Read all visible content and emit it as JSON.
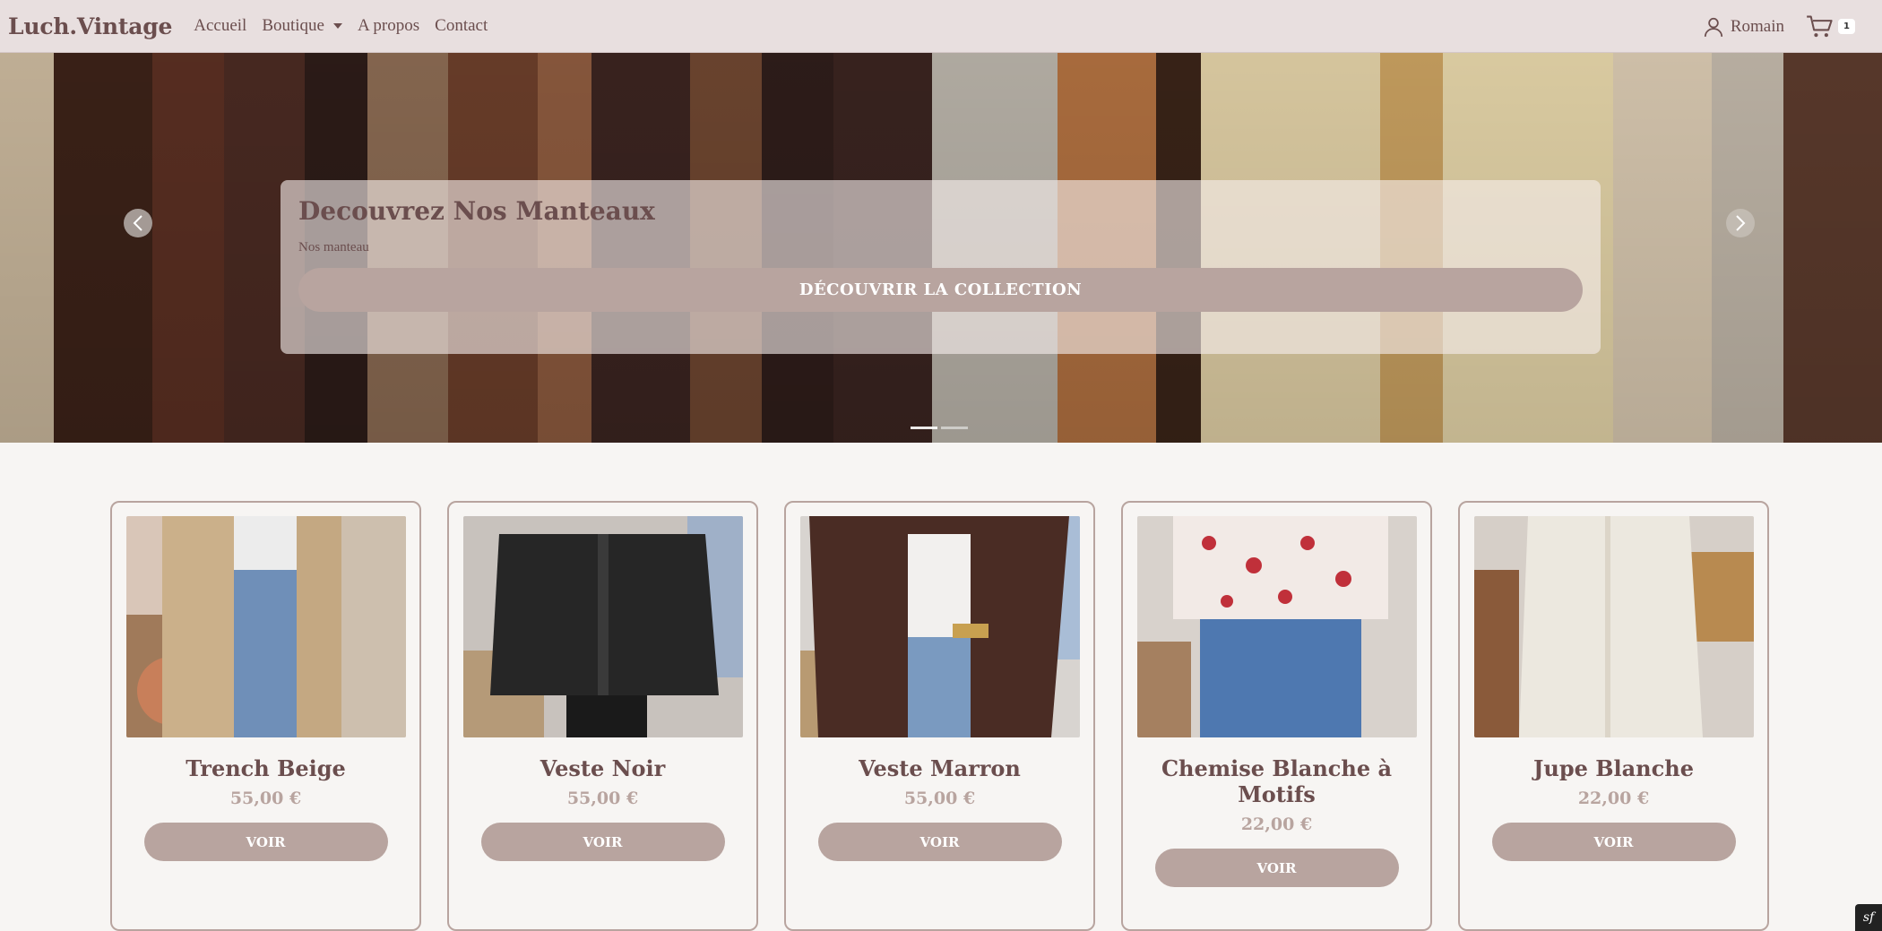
{
  "nav": {
    "brand": "Luch.Vintage",
    "links": [
      "Accueil",
      "Boutique",
      "A propos",
      "Contact"
    ],
    "user_name": "Romain",
    "cart_count": "1"
  },
  "hero": {
    "title": "Decouvrez Nos Manteaux",
    "subtitle": "Nos manteau",
    "button_label": "DÉCOUVRIR LA COLLECTION",
    "slides_count": 2,
    "active_slide": 1
  },
  "products": [
    {
      "name": "Trench Beige",
      "price": "55,00 €",
      "button": "VOIR",
      "photo": "trench-beige-photo"
    },
    {
      "name": "Veste Noir",
      "price": "55,00 €",
      "button": "VOIR",
      "photo": "veste-noir-photo"
    },
    {
      "name": "Veste Marron",
      "price": "55,00 €",
      "button": "VOIR",
      "photo": "veste-marron-photo"
    },
    {
      "name": "Chemise Blanche à Motifs",
      "price": "22,00 €",
      "button": "VOIR",
      "photo": "chemise-blanche-photo"
    },
    {
      "name": "Jupe Blanche",
      "price": "22,00 €",
      "button": "VOIR",
      "photo": "jupe-blanche-photo"
    }
  ],
  "debug_toolbar": "sf",
  "colors": {
    "navbar_bg": "#e8dfdf",
    "text": "#6b4e4e",
    "accent": "#b8a49f",
    "page_bg": "#f7f5f3"
  }
}
